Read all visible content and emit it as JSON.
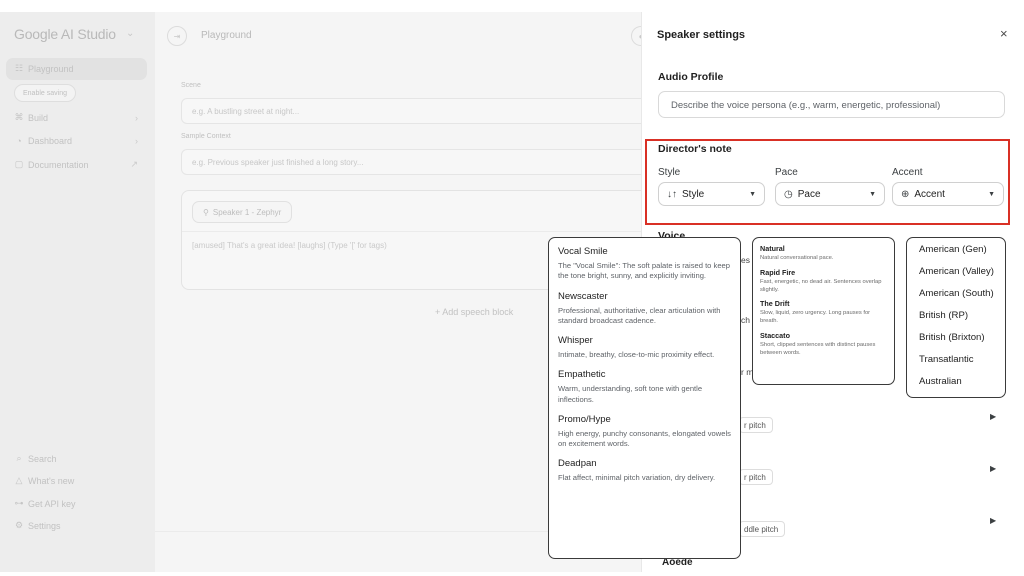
{
  "sidebar": {
    "brand": "Google AI Studio",
    "playground": "Playground",
    "enable_saving": "Enable saving",
    "build": "Build",
    "dashboard": "Dashboard",
    "documentation": "Documentation",
    "search": "Search",
    "whats_new": "What's new",
    "get_api_key": "Get API key",
    "settings": "Settings"
  },
  "main": {
    "title": "Playground",
    "scene_label": "Scene",
    "scene_placeholder": "e.g. A bustling street at night...",
    "context_label": "Sample Context",
    "context_placeholder": "e.g. Previous speaker just finished a long story...",
    "speaker_chip": "Speaker 1 - Zephyr",
    "speaker_text": "[amused] That's a great idea! [laughs] (Type '[' for tags)",
    "add_block": "+ Add speech block"
  },
  "panel": {
    "title": "Speaker settings",
    "close": "×",
    "audio_profile_title": "Audio Profile",
    "audio_profile_placeholder": "Describe the voice persona (e.g., warm, energetic, professional)",
    "director_title": "Director's note",
    "style_label": "Style",
    "pace_label": "Pace",
    "accent_label": "Accent",
    "style_value": "Style",
    "pace_value": "Pace",
    "accent_value": "Accent",
    "voice_title": "Voice",
    "peek_1": "es",
    "peek_2": "ch",
    "peek_3": "r m",
    "pitch_1": "r pitch",
    "pitch_2": "r pitch",
    "pitch_3": "ddle pitch",
    "aoede": "Aoede"
  },
  "style_options": [
    {
      "name": "Vocal Smile",
      "desc": "The \"Vocal Smile\": The soft palate is raised to keep the tone bright, sunny, and explicitly inviting."
    },
    {
      "name": "Newscaster",
      "desc": "Professional, authoritative, clear articulation with standard broadcast cadence."
    },
    {
      "name": "Whisper",
      "desc": "Intimate, breathy, close-to-mic proximity effect."
    },
    {
      "name": "Empathetic",
      "desc": "Warm, understanding, soft tone with gentle inflections."
    },
    {
      "name": "Promo/Hype",
      "desc": "High energy, punchy consonants, elongated vowels on excitement words."
    },
    {
      "name": "Deadpan",
      "desc": "Flat affect, minimal pitch variation, dry delivery."
    }
  ],
  "pace_options": [
    {
      "name": "Natural",
      "desc": "Natural conversational pace."
    },
    {
      "name": "Rapid Fire",
      "desc": "Fast, energetic, no dead air. Sentences overlap slightly."
    },
    {
      "name": "The Drift",
      "desc": "Slow, liquid, zero urgency. Long pauses for breath."
    },
    {
      "name": "Staccato",
      "desc": "Short, clipped sentences with distinct pauses between words."
    }
  ],
  "accent_options": [
    "American (Gen)",
    "American (Valley)",
    "American (South)",
    "British (RP)",
    "British (Brixton)",
    "Transatlantic",
    "Australian"
  ],
  "colors": {
    "highlight": "#d93025"
  }
}
